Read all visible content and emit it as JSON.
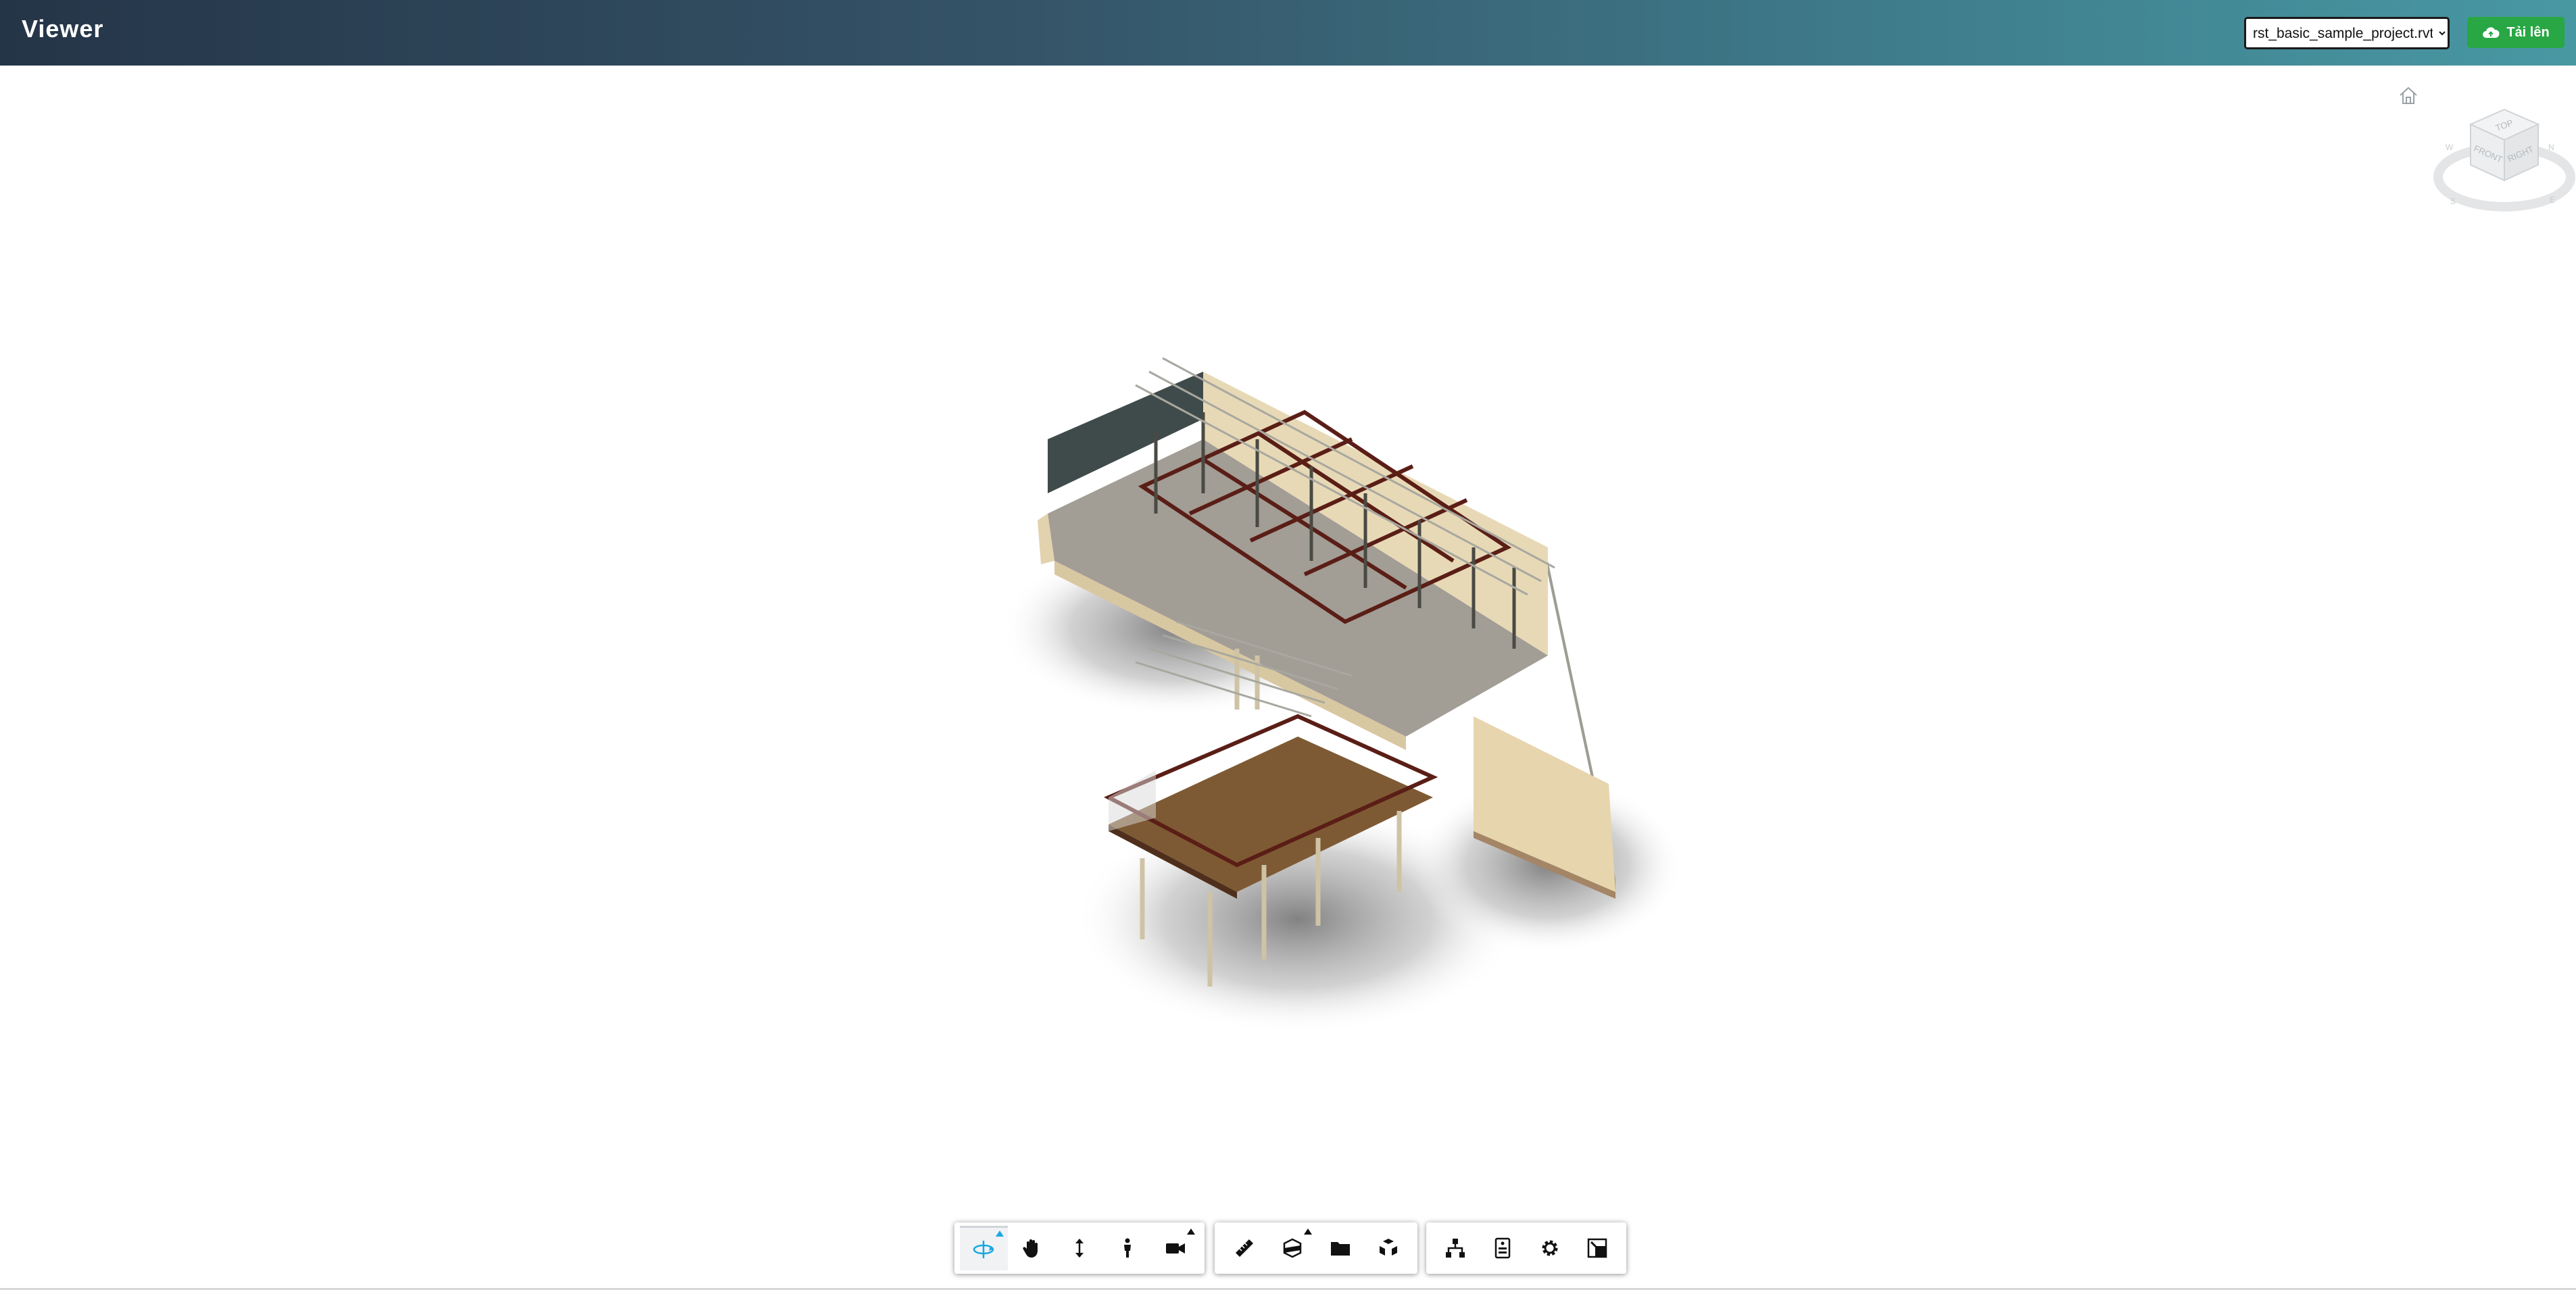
{
  "header": {
    "title": "Viewer",
    "model_select": {
      "selected": "rst_basic_sample_project.rvt",
      "options": [
        "rst_basic_sample_project.rvt"
      ]
    },
    "upload_button": {
      "label": "Tải lên",
      "icon": "cloud-upload-icon",
      "color": "#28a744"
    }
  },
  "viewcube": {
    "top": "TOP",
    "front": "FRONT",
    "right": "RIGHT",
    "compass": [
      "N",
      "E",
      "S",
      "W"
    ]
  },
  "toolbar": {
    "navigation": [
      "orbit-icon",
      "pan-icon",
      "zoom-icon",
      "first-person-icon",
      "camera-icon"
    ],
    "tools": [
      "measure-icon",
      "section-icon",
      "explode-icon",
      "model-browser-icon"
    ],
    "settings": [
      "structure-icon",
      "properties-icon",
      "settings-icon",
      "fullscreen-icon"
    ],
    "active_color": "#19a8e0"
  }
}
